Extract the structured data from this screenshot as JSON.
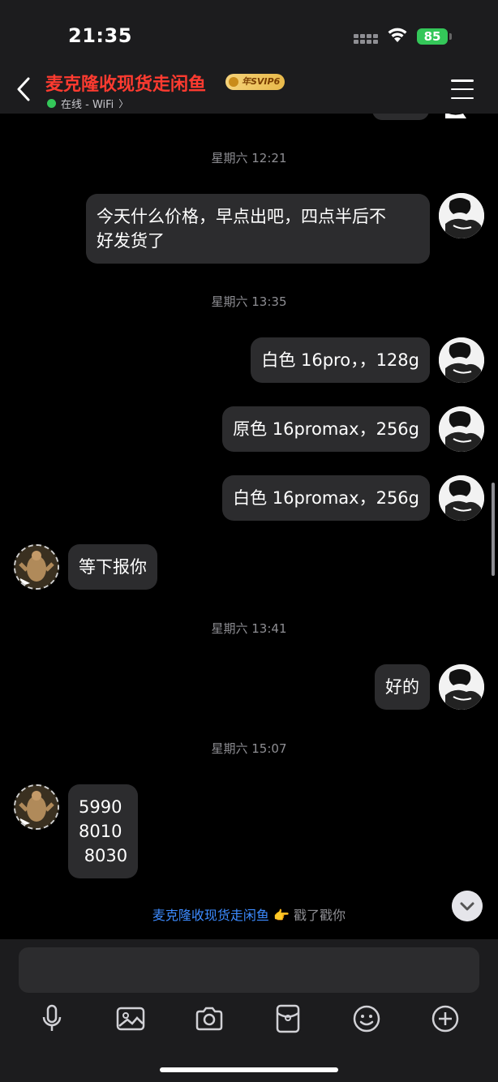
{
  "status_bar": {
    "time": "21:35",
    "battery": "85"
  },
  "header": {
    "title": "麦克隆收现货走闲鱼",
    "vip_badge": "年SVIP6",
    "status": "在线 - WiFi",
    "status_chevron": "〉"
  },
  "messages": [
    {
      "type": "timestamp",
      "text": "星期六 12:21"
    },
    {
      "type": "bubble",
      "side": "right",
      "text": "今天什么价格，早点出吧，四点半后不\n好发货了"
    },
    {
      "type": "timestamp",
      "text": "星期六 13:35"
    },
    {
      "type": "bubble",
      "side": "right",
      "text": "白色 16pro，，128g"
    },
    {
      "type": "bubble",
      "side": "right",
      "text": "原色 16promax，256g"
    },
    {
      "type": "bubble",
      "side": "right",
      "text": "白色 16promax，256g"
    },
    {
      "type": "bubble",
      "side": "left",
      "text": "等下报你"
    },
    {
      "type": "timestamp",
      "text": "星期六 13:41"
    },
    {
      "type": "bubble",
      "side": "right",
      "text": "好的"
    },
    {
      "type": "timestamp",
      "text": "星期六 15:07"
    },
    {
      "type": "bubble",
      "side": "left",
      "text": "5990\n8010\n 8030"
    }
  ],
  "poke": {
    "name": "麦克隆收现货走闲鱼",
    "action": "戳了戳你"
  },
  "icons": {
    "back": "chevron-left-icon",
    "menu": "hamburger-menu-icon",
    "toolbar": [
      "microphone-icon",
      "image-icon",
      "camera-icon",
      "red-packet-icon",
      "emoji-icon",
      "plus-icon"
    ]
  },
  "colors": {
    "title": "#ff3b30",
    "online": "#34c759",
    "poke_name": "#3d8bff",
    "bubble": "#2c2c2e"
  }
}
